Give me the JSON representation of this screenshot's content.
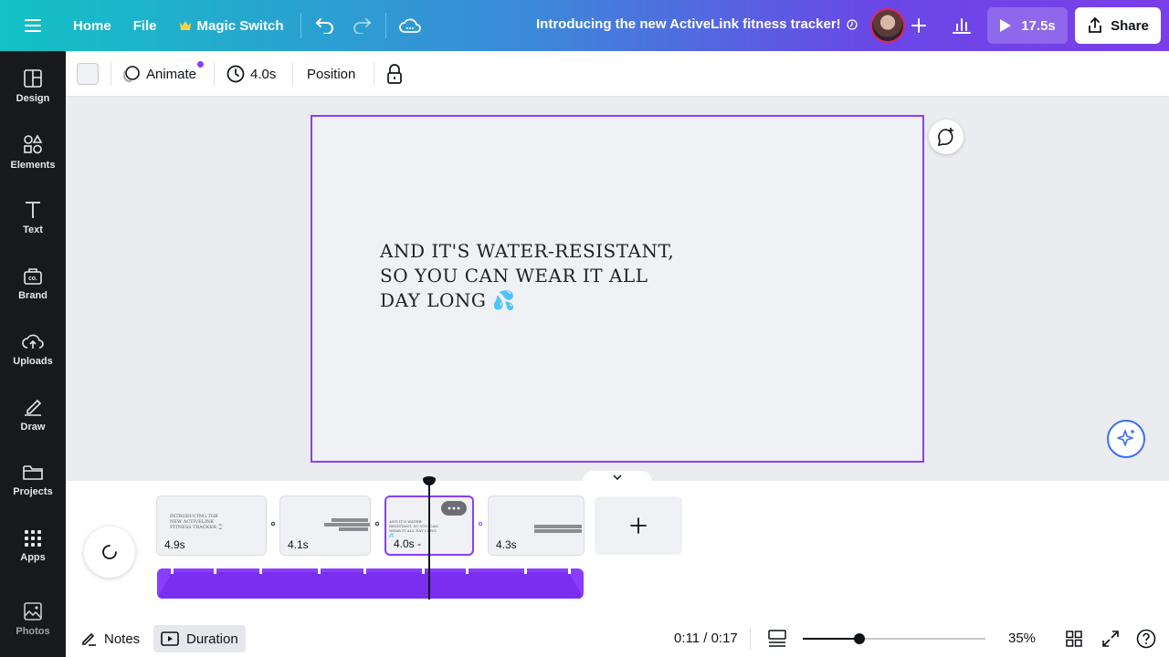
{
  "topbar": {
    "home_label": "Home",
    "file_label": "File",
    "magic_switch_label": "Magic Switch",
    "design_title": "Introducing the new ActiveLink fitness tracker!",
    "play_duration": "17.5s",
    "share_label": "Share"
  },
  "sidebar": {
    "items": [
      {
        "label": "Design",
        "icon": "design-icon"
      },
      {
        "label": "Elements",
        "icon": "elements-icon"
      },
      {
        "label": "Text",
        "icon": "text-icon"
      },
      {
        "label": "Brand",
        "icon": "brand-icon"
      },
      {
        "label": "Uploads",
        "icon": "uploads-icon"
      },
      {
        "label": "Draw",
        "icon": "draw-icon"
      },
      {
        "label": "Projects",
        "icon": "projects-icon"
      },
      {
        "label": "Apps",
        "icon": "apps-icon"
      },
      {
        "label": "Photos",
        "icon": "photos-icon"
      }
    ]
  },
  "toolbar": {
    "background_color": "#f0f1f4",
    "animate_label": "Animate",
    "duration_label": "4.0s",
    "position_label": "Position"
  },
  "canvas": {
    "page_text": "And it's water-resistant, so you can wear it all day long 💦",
    "accent_color": "#8b3dff"
  },
  "timeline": {
    "clips": [
      {
        "duration": "4.9s",
        "preview_text": "Introducing the new ActiveLink fitness tracker ⌚"
      },
      {
        "duration": "4.1s",
        "preview_text": ""
      },
      {
        "duration": "4.0s -",
        "preview_text": "And it's water-resistant, so you can wear it all day long 💦"
      },
      {
        "duration": "4.3s",
        "preview_text": ""
      }
    ]
  },
  "footer": {
    "notes_label": "Notes",
    "duration_label": "Duration",
    "time_display": "0:11 / 0:17",
    "zoom_level": "35%",
    "zoom_fraction": 0.31
  }
}
